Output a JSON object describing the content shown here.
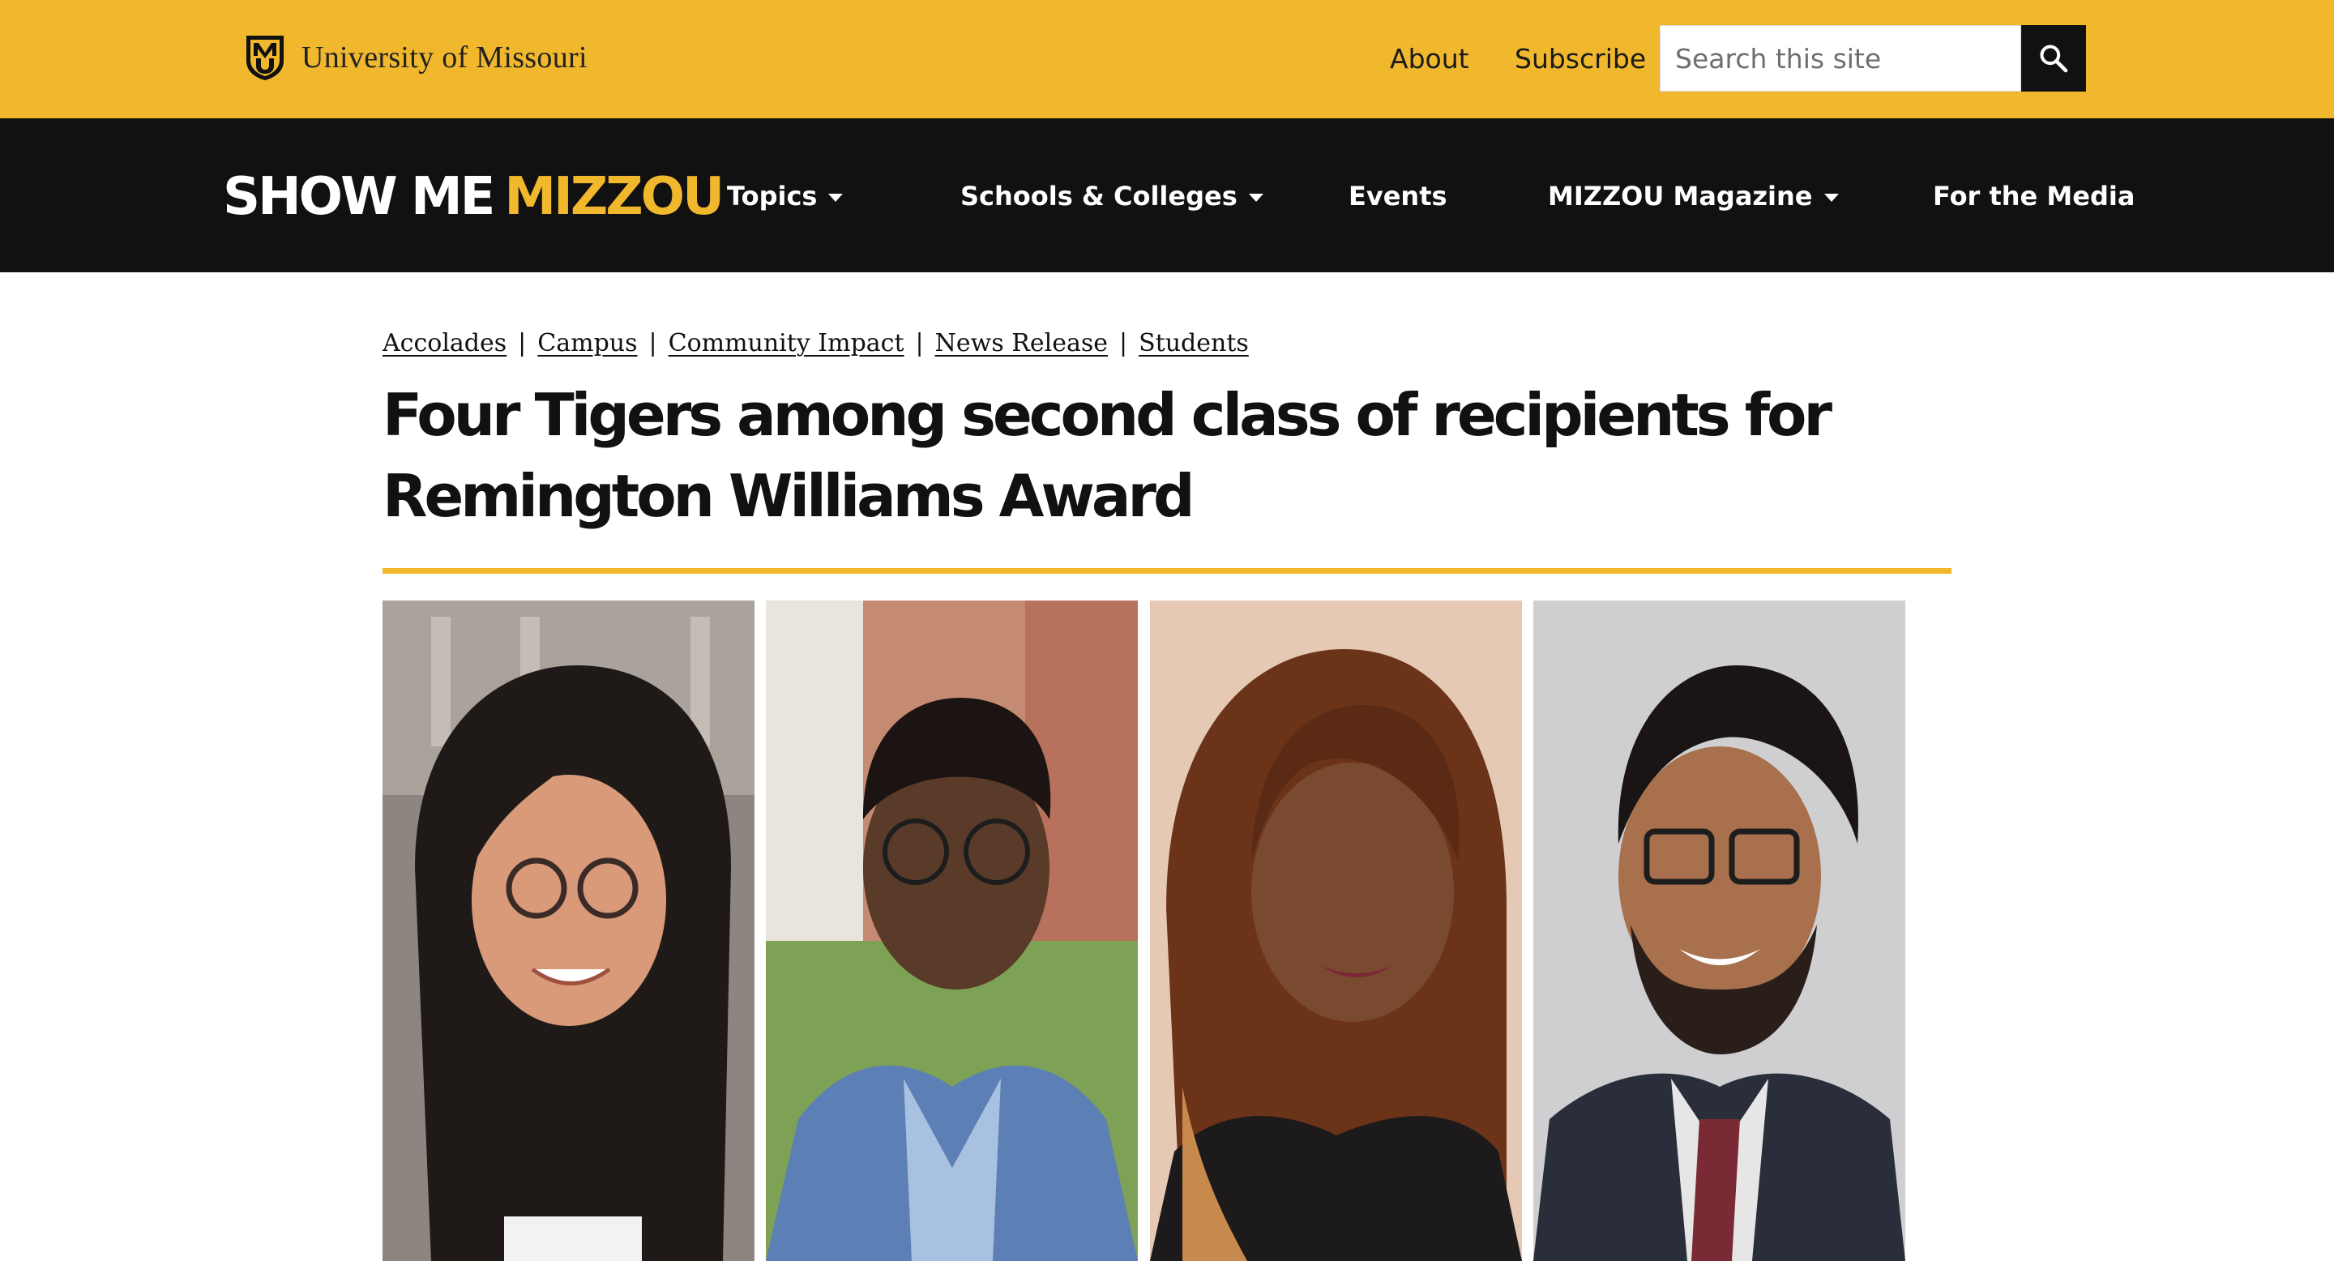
{
  "utility": {
    "brand_name": "University of Missouri",
    "about_label": "About",
    "subscribe_label": "Subscribe",
    "search_placeholder": "Search this site"
  },
  "site": {
    "logo_part1": "SHOW ME",
    "logo_part2": "MIZZOU"
  },
  "nav": {
    "items": [
      {
        "label": "Topics",
        "has_dropdown": true
      },
      {
        "label": "Schools & Colleges",
        "has_dropdown": true
      },
      {
        "label": "Events",
        "has_dropdown": false
      },
      {
        "label": "MIZZOU Magazine",
        "has_dropdown": true
      },
      {
        "label": "For the Media",
        "has_dropdown": false
      }
    ]
  },
  "article": {
    "categories": [
      "Accolades",
      "Campus",
      "Community Impact",
      "News Release",
      "Students"
    ],
    "category_separator": "|",
    "title": "Four Tigers among second class of recipients for Remington Williams Award"
  },
  "colors": {
    "gold": "#F1B82D",
    "black": "#111111",
    "white": "#ffffff"
  },
  "icons": {
    "search": "magnifier-icon",
    "brand": "mu-shield-icon",
    "dropdown": "caret-down-icon"
  }
}
